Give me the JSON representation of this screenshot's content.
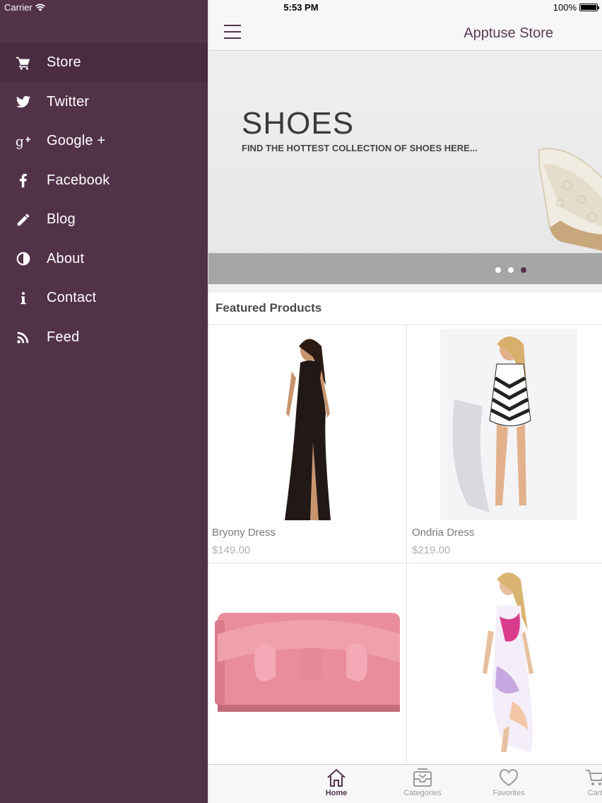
{
  "status_bar": {
    "carrier": "Carrier",
    "time": "5:53 PM",
    "battery": "100%"
  },
  "sidebar": {
    "items": [
      {
        "label": "Store",
        "icon": "cart-icon",
        "active": true
      },
      {
        "label": "Twitter",
        "icon": "twitter-icon"
      },
      {
        "label": "Google +",
        "icon": "google-plus-icon"
      },
      {
        "label": "Facebook",
        "icon": "facebook-icon"
      },
      {
        "label": "Blog",
        "icon": "pencil-icon"
      },
      {
        "label": "About",
        "icon": "contrast-icon"
      },
      {
        "label": "Contact",
        "icon": "info-icon"
      },
      {
        "label": "Feed",
        "icon": "rss-icon"
      }
    ]
  },
  "header": {
    "title": "Apptuse Store"
  },
  "banner": {
    "title": "SHOES",
    "subtitle": "FIND THE HOTTEST COLLECTION OF SHOES HERE...",
    "slides": 3,
    "active_slide": 3
  },
  "featured": {
    "title": "Featured Products",
    "products": [
      {
        "name": "Bryony Dress",
        "price": "$149.00"
      },
      {
        "name": "Ondria Dress",
        "price": "$219.00"
      },
      {
        "name": "",
        "price": ""
      },
      {
        "name": "",
        "price": ""
      }
    ]
  },
  "tabbar": {
    "tabs": [
      {
        "label": "Home",
        "icon": "home-icon",
        "active": true
      },
      {
        "label": "Categories",
        "icon": "inbox-icon"
      },
      {
        "label": "Favorites",
        "icon": "heart-icon"
      },
      {
        "label": "Cart",
        "icon": "cart-icon"
      }
    ]
  },
  "colors": {
    "sidebar_bg": "#523249",
    "sidebar_active": "#4a2b42",
    "accent": "#523249"
  }
}
